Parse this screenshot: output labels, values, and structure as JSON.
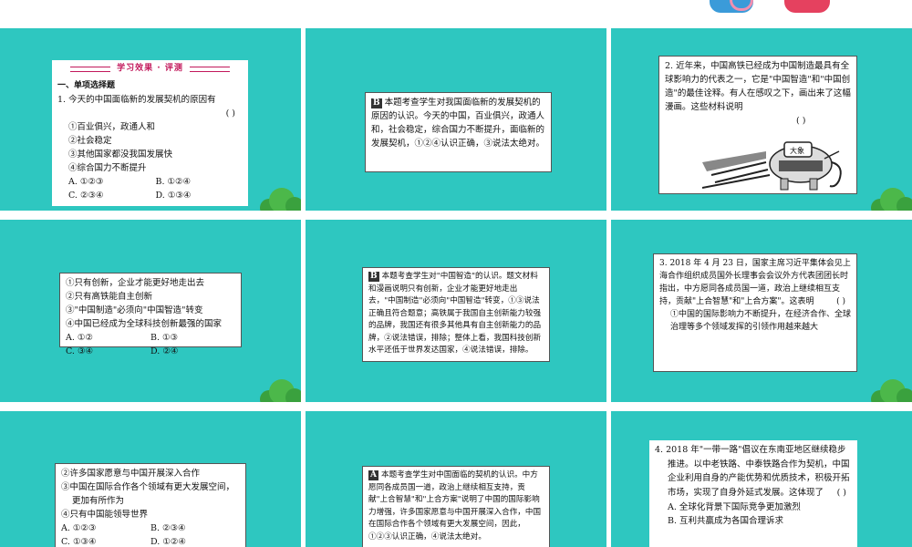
{
  "colors": {
    "slide_bg": "#2ec7c0",
    "tree_green": "#3aa13e",
    "header_accent": "#c2185b"
  },
  "slide1": {
    "header": "学习效果 · 评测",
    "section": "一、单项选择题",
    "question": "1. 今天的中国面临新的发展契机的原因有",
    "paren": "(          )",
    "items": [
      "①百业俱兴，政通人和",
      "②社会稳定",
      "③其他国家都没我国发展快",
      "④综合国力不断提升"
    ],
    "opt_a": "A. ①②③",
    "opt_b": "B. ①②④",
    "opt_c": "C. ②③④",
    "opt_d": "D. ①③④"
  },
  "slide2": {
    "answer": "B",
    "text": "本题考查学生对我国面临新的发展契机的原因的认识。今天的中国，百业俱兴，政通人和，社会稳定，综合国力不断提升，面临新的发展契机，①②④认识正确，③说法太绝对。"
  },
  "slide3": {
    "question": "2. 近年来，中国高铁已经成为中国制造最具有全球影响力的代表之一，它是\"中国智造\"和\"中国创造\"的最佳诠释。有人在感叹之下，画出来了这幅漫画。这些材料说明",
    "paren": "(          )",
    "cartoon_label": "大象",
    "cartoon_icon": "elephant-train-cartoon"
  },
  "slide4": {
    "items": [
      "①只有创新，企业才能更好地走出去",
      "②只有高铁能自主创新",
      "③\"中国制造\"必须向\"中国智造\"转变",
      "④中国已经成为全球科技创新最强的国家"
    ],
    "opt_a": "A. ①②",
    "opt_b": "B. ①③",
    "opt_c": "C. ③④",
    "opt_d": "D. ②④"
  },
  "slide5": {
    "answer": "B",
    "text": "本题考查学生对\"中国智造\"的认识。题文材料和漫画说明只有创新，企业才能更好地走出去，\"中国制造\"必须向\"中国智造\"转变，①③说法正确且符合题意；高铁属于我国自主创新能力较强的品牌，我国还有很多其他具有自主创新能力的品牌，②说法错误，排除；整体上看，我国科技创新水平还低于世界发达国家，④说法错误，排除。"
  },
  "slide6": {
    "question": "3. 2018 年 4 月 23 日，国家主席习近平集体会见上海合作组织成员国外长理事会会议外方代表团团长时指出，中方愿同各成员国一道，政治上继续相互支持，贡献\"上合智慧\"和\"上合方案\"。这表明",
    "paren": "(          )",
    "items": [
      "①中国的国际影响力不断提升，在经济合作、全球治理等多个领域发挥的引领作用越来越大"
    ]
  },
  "slide7": {
    "items": [
      "②许多国家愿意与中国开展深入合作",
      "③中国在国际合作各个领域有更大发展空间，更加有所作为",
      "④只有中国能领导世界"
    ],
    "opt_a": "A. ①②③",
    "opt_b": "B. ②③④",
    "opt_c": "C. ①③④",
    "opt_d": "D. ①②④"
  },
  "slide8": {
    "answer": "A",
    "text": "本题考查学生对中国面临的契机的认识。中方愿同各成员国一道，政治上继续相互支持，贡献\"上合智慧\"和\"上合方案\"说明了中国的国际影响力增强，许多国家愿意与中国开展深入合作，中国在国际合作各个领域有更大发展空间，因此，①②③认识正确，④说法太绝对。"
  },
  "slide9": {
    "question": "4. 2018 年\"一带一路\"倡议在东南亚地区继续稳步推进。以中老铁路、中泰铁路合作为契机，中国企业利用自身的产能优势和优质技术，积极开拓市场，实现了自身外延式发展。这体现了",
    "paren": "(          )",
    "opt_a": "A. 全球化背景下国际竞争更加激烈",
    "opt_b": "B. 互利共赢成为各国合理诉求"
  }
}
